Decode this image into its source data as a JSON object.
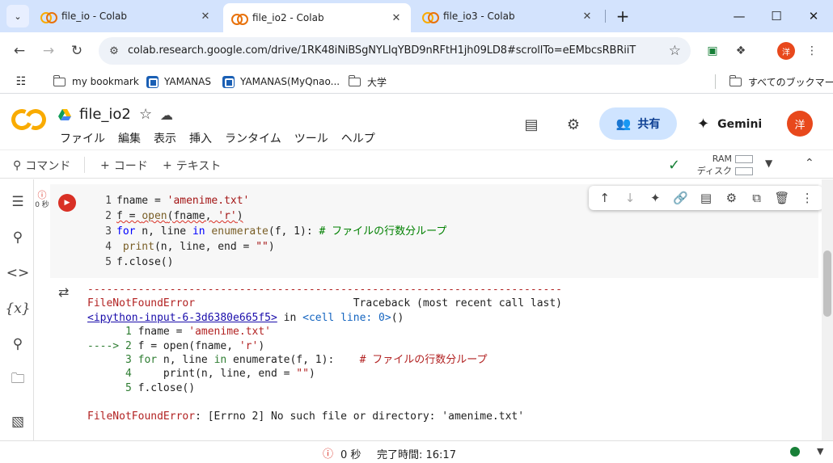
{
  "browser": {
    "tabs": [
      {
        "title": "file_io - Colab",
        "active": false
      },
      {
        "title": "file_io2 - Colab",
        "active": true
      },
      {
        "title": "file_io3 - Colab",
        "active": false
      }
    ],
    "url": "colab.research.google.com/drive/1RK48iNiBSgNYLIqYBD9nRFtH1jh09LD8#scrollTo=eEMbcsRBRiiT",
    "profile_initial": "洋",
    "bookmarks": [
      "my bookmark",
      "YAMANAS",
      "YAMANAS(MyQnao...",
      "大学"
    ],
    "all_bookmarks": "すべてのブックマーク"
  },
  "colab": {
    "file_name": "file_io2",
    "menu": [
      "ファイル",
      "編集",
      "表示",
      "挿入",
      "ランタイム",
      "ツール",
      "ヘルプ"
    ],
    "share_label": "共有",
    "gemini_label": "Gemini",
    "user_initial": "洋",
    "toolbar": {
      "commands": "コマンド",
      "add_code": "コード",
      "add_text": "テキスト",
      "ram_label": "RAM",
      "disk_label": "ディスク"
    }
  },
  "cell": {
    "exec_time": "0 秒",
    "line_numbers": [
      "1",
      "2",
      "3",
      "4",
      "5"
    ]
  },
  "status": {
    "elapsed": "0 秒",
    "completed": "完了時間: 16:17"
  },
  "colors": {
    "accent": "#1a73e8",
    "error": "#d93025",
    "success": "#188038",
    "colab_orange": "#f9ab00"
  }
}
